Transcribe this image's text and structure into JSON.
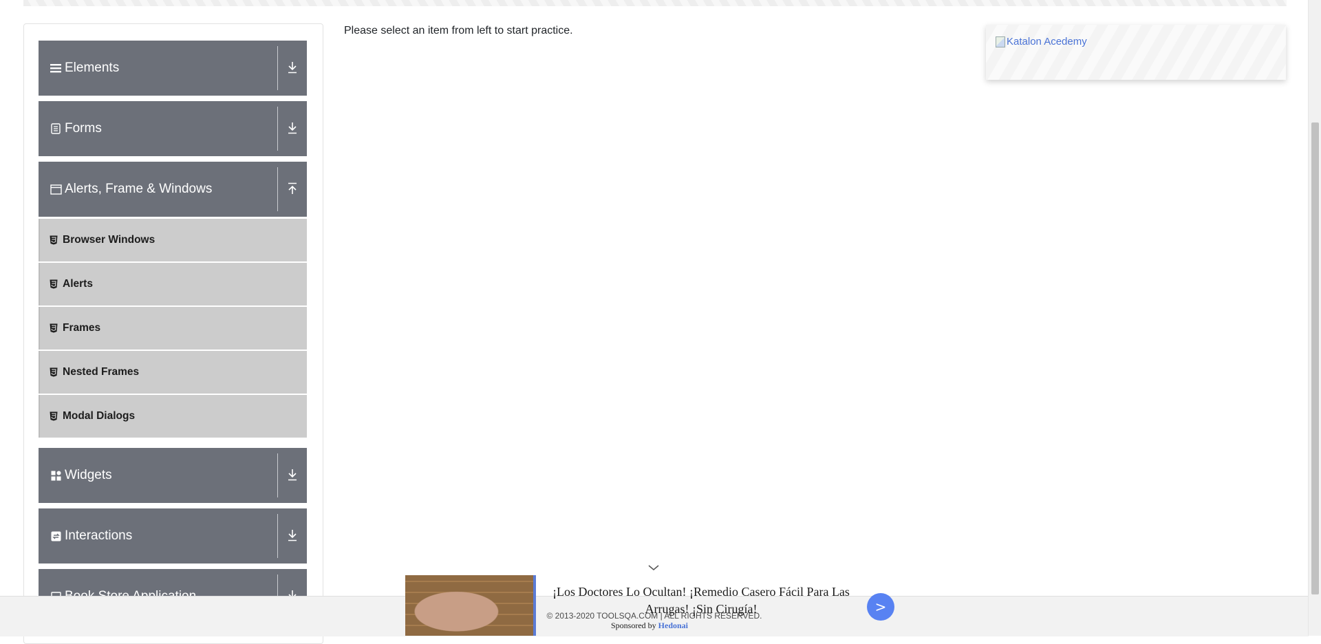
{
  "sidebar": {
    "groups": [
      {
        "label": "Elements",
        "icon": "hamburger-icon",
        "state": "collapsed"
      },
      {
        "label": "Forms",
        "icon": "document-icon",
        "state": "collapsed"
      },
      {
        "label": "Alerts, Frame & Windows",
        "icon": "window-icon",
        "state": "expanded",
        "items": [
          {
            "label": "Browser Windows",
            "icon": "html5-icon"
          },
          {
            "label": "Alerts",
            "icon": "html5-icon"
          },
          {
            "label": "Frames",
            "icon": "html5-icon"
          },
          {
            "label": "Nested Frames",
            "icon": "html5-icon"
          },
          {
            "label": "Modal Dialogs",
            "icon": "html5-icon"
          }
        ]
      },
      {
        "label": "Widgets",
        "icon": "grid-icon",
        "state": "collapsed"
      },
      {
        "label": "Interactions",
        "icon": "interaction-icon",
        "state": "collapsed"
      },
      {
        "label": "Book Store Application",
        "icon": "book-icon",
        "state": "collapsed"
      }
    ]
  },
  "main": {
    "instruction": "Please select an item from left to start practice."
  },
  "ad_banner": {
    "alt_text": "Katalon Acedemy"
  },
  "bottom_ad": {
    "headline": "¡Los Doctores Lo Ocultan! ¡Remedio Casero Fácil Para Las Arrugas! ¡Sin Cirugía!",
    "cta": ">",
    "sponsor_prefix": "Sponsored by",
    "sponsor_brand": "Hedonai"
  },
  "footer": {
    "copyright": "© 2013-2020 TOOLSQA.COM | ALL RIGHTS RESERVED."
  },
  "colors": {
    "group_header_bg": "#6c7079",
    "sub_item_bg": "#cccccc",
    "link": "#4a73d6",
    "cta": "#5882f2"
  }
}
